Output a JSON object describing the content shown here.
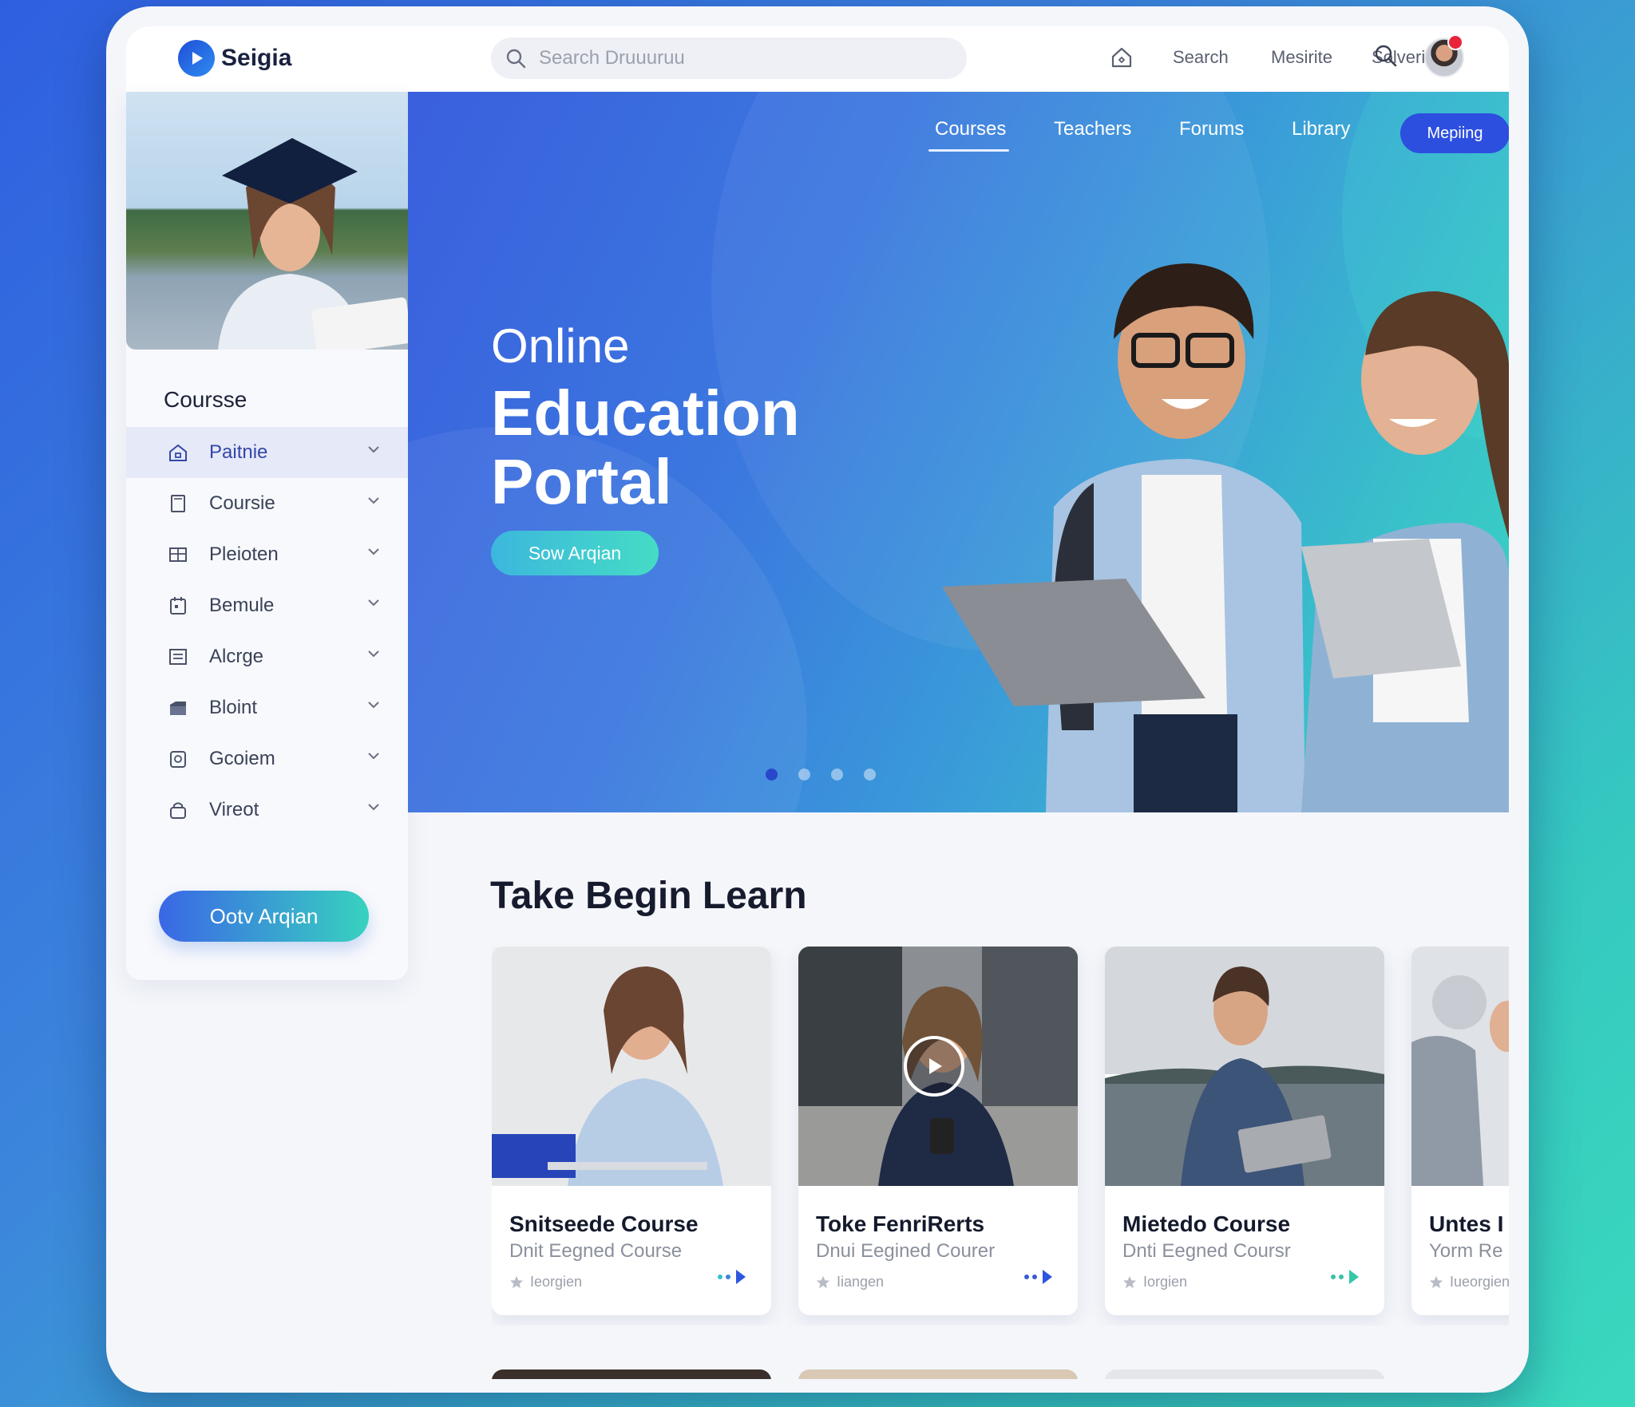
{
  "app": {
    "name": "Seigia",
    "accent": "#2c4fe0",
    "gradient": [
      "#3a5fde",
      "#38d5bf"
    ]
  },
  "topbar": {
    "search_placeholder": "Search Druuuruu",
    "links": [
      "Search",
      "Mesirite",
      "Solverior"
    ],
    "icons": [
      "home-icon",
      "search-icon"
    ],
    "notification_badge_color": "#e8233a"
  },
  "sidebar": {
    "heading": "Coursse",
    "items": [
      {
        "label": "Paitnie",
        "icon": "home-icon",
        "active": true
      },
      {
        "label": "Coursie",
        "icon": "book-icon",
        "active": false
      },
      {
        "label": "Pleioten",
        "icon": "grid-icon",
        "active": false
      },
      {
        "label": "Bemule",
        "icon": "calendar-icon",
        "active": false
      },
      {
        "label": "Alcrge",
        "icon": "list-icon",
        "active": false
      },
      {
        "label": "Bloint",
        "icon": "folder-icon",
        "active": false
      },
      {
        "label": "Gcoiem",
        "icon": "clipboard-icon",
        "active": false
      },
      {
        "label": "Vireot",
        "icon": "lock-icon",
        "active": false
      }
    ],
    "cta_label": "Ootv Arqian"
  },
  "hero": {
    "tabs": [
      {
        "label": "Courses",
        "active": true
      },
      {
        "label": "Teachers",
        "active": false
      },
      {
        "label": "Forums",
        "active": false
      },
      {
        "label": "Library",
        "active": false
      }
    ],
    "pill_label": "Mepiing",
    "title_line1": "Online",
    "title_line2": "Education",
    "title_line3": "Portal",
    "cta_label": "Sow Arqian",
    "slides_total": 4,
    "slide_active": 1
  },
  "courses": {
    "section_title": "Take Begin Learn",
    "cards": [
      {
        "title": "Snitseede Course",
        "subtitle": "Dnit Eegned Course",
        "meta": "Ieorgien",
        "has_play": false
      },
      {
        "title": "Toke FenriRerts",
        "subtitle": "Dnui Eegined Courer",
        "meta": "Iiangen",
        "has_play": true
      },
      {
        "title": "Mietedo Course",
        "subtitle": "Dnti Eegned Coursr",
        "meta": "Iorgien",
        "has_play": false
      },
      {
        "title": "Untes I",
        "subtitle": "Yorm Re",
        "meta": "Iueorgien",
        "has_play": false
      }
    ]
  }
}
